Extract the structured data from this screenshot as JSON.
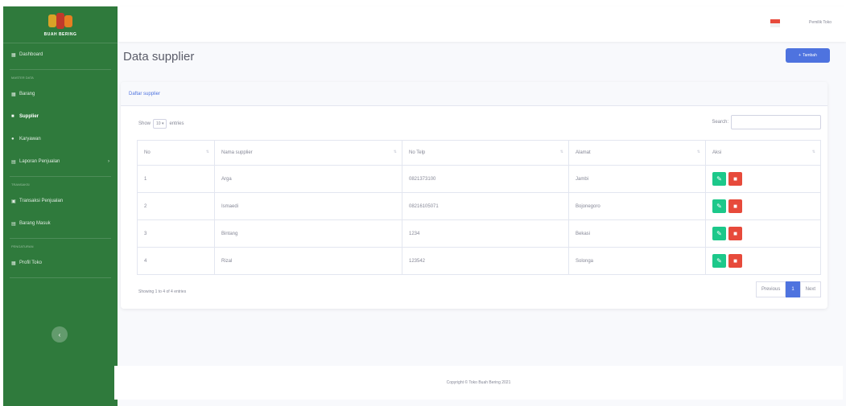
{
  "brand": {
    "name": "BUAH BERING"
  },
  "sidebar": {
    "items": [
      {
        "label": "Dashboard",
        "icon": "tachometer-icon"
      },
      {
        "heading": "MASTER DATA"
      },
      {
        "label": "Barang",
        "icon": "box-icon"
      },
      {
        "label": "Supplier",
        "icon": "truck-icon",
        "active": true
      },
      {
        "label": "Karyawan",
        "icon": "user-icon"
      },
      {
        "label": "Laporan Penjualan",
        "icon": "file-icon",
        "caret": "›"
      },
      {
        "heading": "TRANSAKSI"
      },
      {
        "label": "Transaksi Penjualan",
        "icon": "cart-icon"
      },
      {
        "label": "Barang Masuk",
        "icon": "inbox-icon"
      },
      {
        "heading": "PENGATURAN"
      },
      {
        "label": "Profil Toko",
        "icon": "store-icon"
      }
    ],
    "toggle": "‹"
  },
  "topbar": {
    "user": "Pemilik Toko"
  },
  "page": {
    "title": "Data supplier",
    "add_button": "Tambah",
    "add_icon": "+"
  },
  "card": {
    "header": "Daftar supplier",
    "show_prefix": "Show",
    "show_value": "10 ▾",
    "show_suffix": "entries",
    "search_label": "Search:",
    "columns": [
      "No",
      "Nama supplier",
      "No Telp",
      "Alamat",
      "Aksi"
    ],
    "rows": [
      {
        "no": "1",
        "nama": "Arga",
        "telp": "0821373100",
        "alamat": "Jambi"
      },
      {
        "no": "2",
        "nama": "Ismaedi",
        "telp": "08216105071",
        "alamat": "Bojonegoro"
      },
      {
        "no": "3",
        "nama": "Bintang",
        "telp": "1234",
        "alamat": "Bekasi"
      },
      {
        "no": "4",
        "nama": "Rizal",
        "telp": "123542",
        "alamat": "Solonga"
      }
    ],
    "info": "Showing 1 to 4 of 4 entries",
    "pagination": {
      "prev": "Previous",
      "current": "1",
      "next": "Next"
    }
  },
  "footer": {
    "text": "Copyright © Toko Buah Bering 2021"
  },
  "colors": {
    "sidebar": "#2f7a3c",
    "primary": "#4e73df",
    "success": "#1cc88a",
    "danger": "#e74a3b"
  }
}
